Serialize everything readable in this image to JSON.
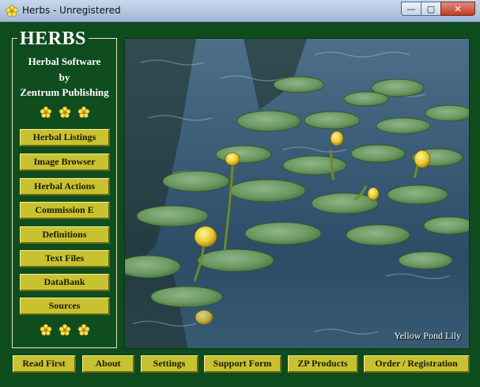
{
  "window": {
    "title": "Herbs - Unregistered",
    "minimize_glyph": "—",
    "maximize_glyph": "▢",
    "close_glyph": "✕"
  },
  "brand": {
    "logo_text": "HERBS",
    "line1": "Herbal Software",
    "line2": "by",
    "line3": "Zentrum Publishing"
  },
  "nav": {
    "items": [
      {
        "label": "Herbal Listings"
      },
      {
        "label": "Image Browser"
      },
      {
        "label": "Herbal Actions"
      },
      {
        "label": "Commission E"
      },
      {
        "label": "Definitions"
      },
      {
        "label": "Text Files"
      },
      {
        "label": "DataBank"
      },
      {
        "label": "Sources"
      }
    ]
  },
  "image": {
    "caption": "Yellow Pond Lily"
  },
  "footer": {
    "buttons": [
      {
        "label": "Read First"
      },
      {
        "label": "About"
      },
      {
        "label": "Settings"
      },
      {
        "label": "Support Form"
      },
      {
        "label": "ZP Products"
      },
      {
        "label": "Order / Registration"
      }
    ]
  },
  "colors": {
    "background": "#0e4b1d",
    "button_face": "#c8c230",
    "text_light": "#ffffff"
  },
  "icons": {
    "app": "flower-icon",
    "decoration": "flower-icon"
  }
}
